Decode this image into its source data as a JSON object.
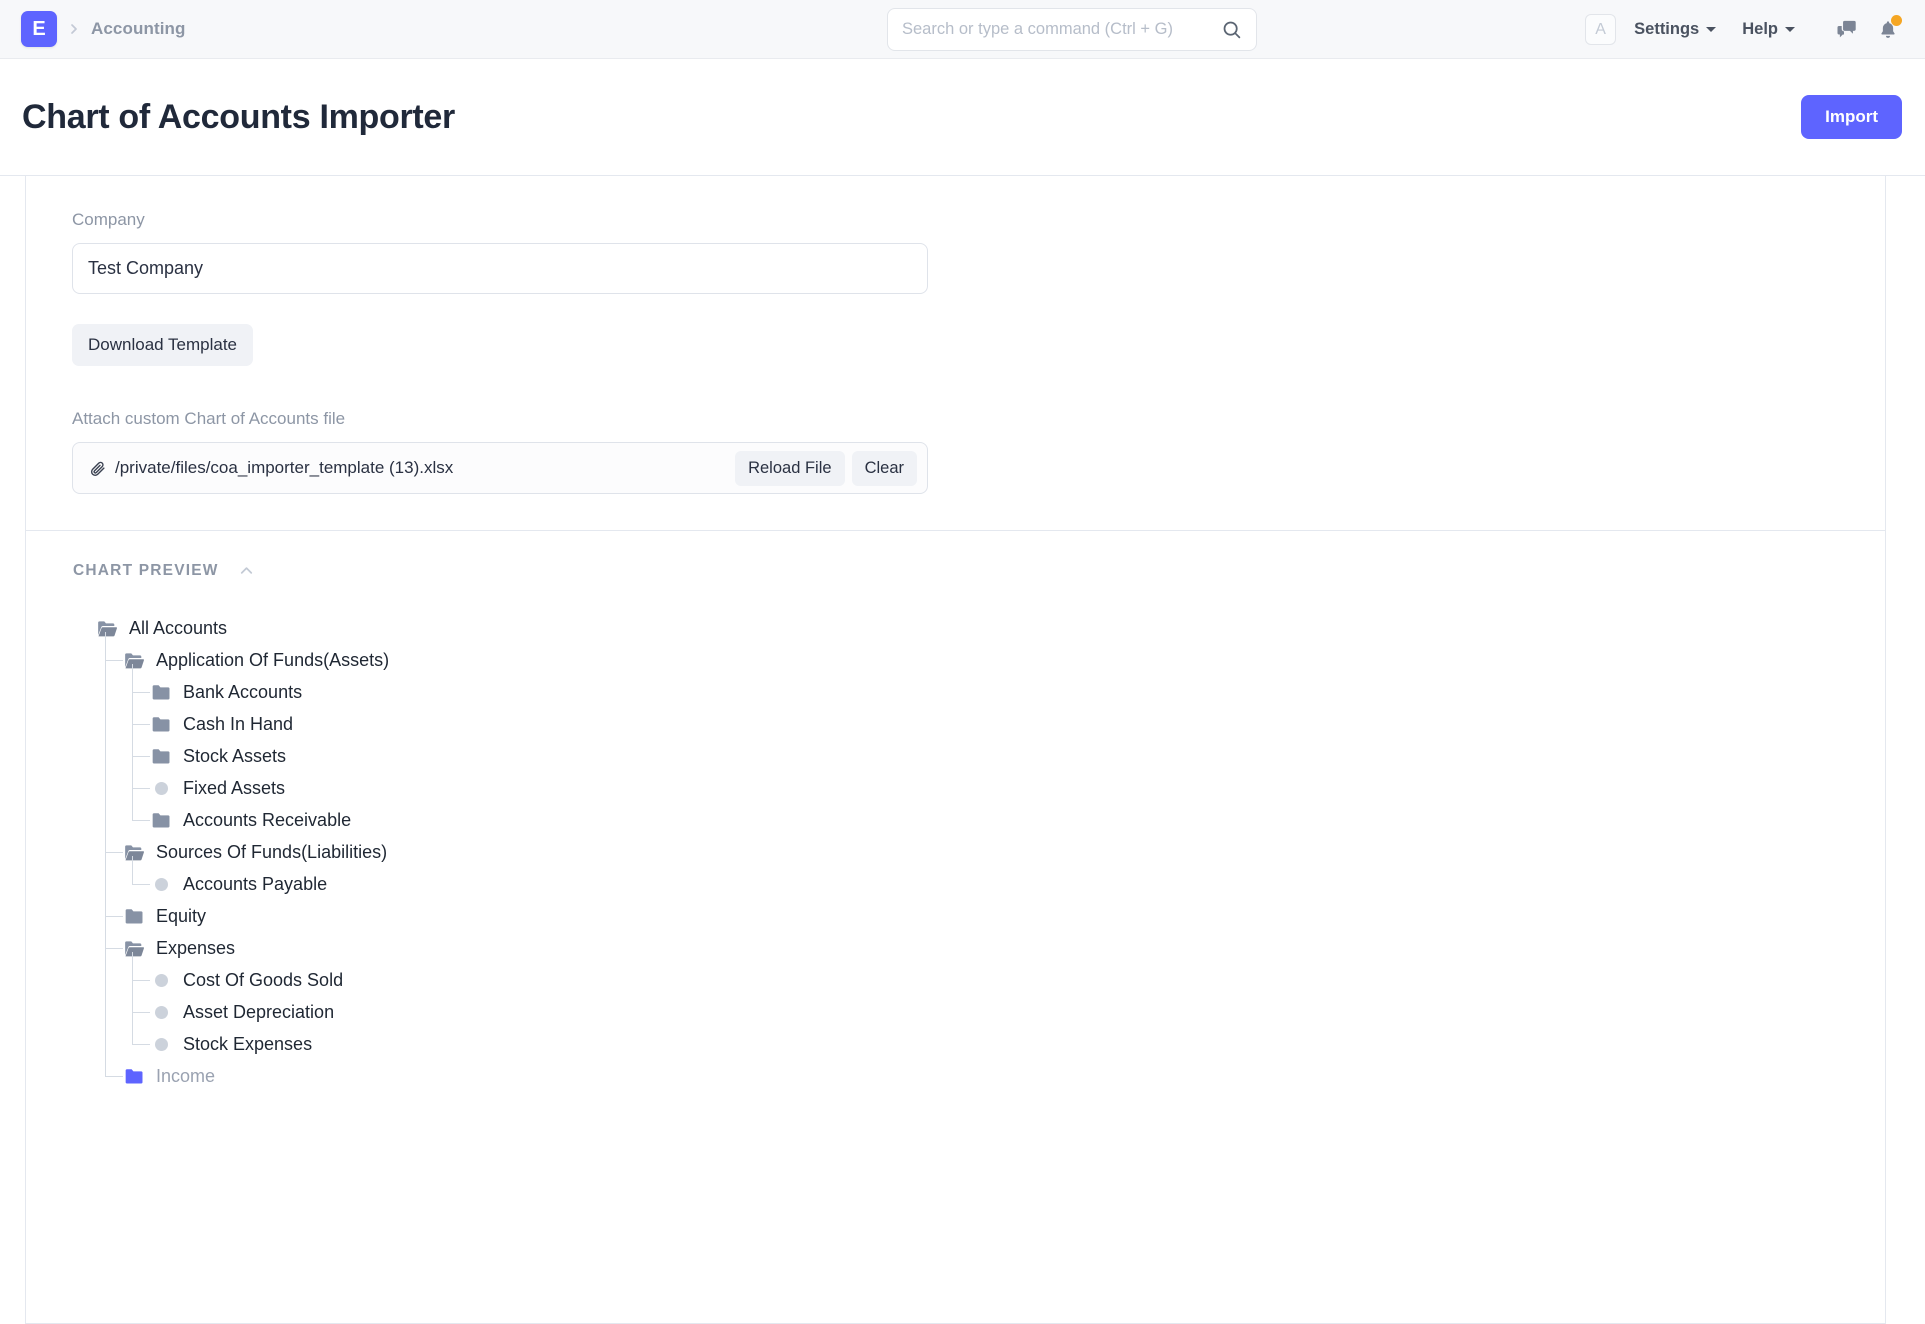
{
  "navbar": {
    "logo_letter": "E",
    "breadcrumb": "Accounting",
    "chevron_icon": "chevron-right-icon",
    "search": {
      "placeholder": "Search or type a command (Ctrl + G)",
      "value": "",
      "icon": "search-icon"
    },
    "avatar_letter": "A",
    "settings_label": "Settings",
    "help_label": "Help",
    "chat_icon": "chat-bubbles-icon",
    "bell_icon": "bell-icon",
    "has_notification": true,
    "notification_color": "#f5a623"
  },
  "page": {
    "title": "Chart of Accounts Importer",
    "import_label": "Import",
    "accent_color": "#5e64ff"
  },
  "form": {
    "company_label": "Company",
    "company_value": "Test Company",
    "company_placeholder": "",
    "download_template_label": "Download Template",
    "attach_label": "Attach custom Chart of Accounts file",
    "attach_file_name": "/private/files/coa_importer_template (13).xlsx",
    "attach_clip_icon": "paperclip-icon",
    "reload_label": "Reload File",
    "clear_label": "Clear"
  },
  "preview": {
    "section_title": "CHART PREVIEW",
    "collapse_icon": "chevron-up-icon",
    "tree": {
      "label": "All Accounts",
      "icon": "folder-open-icon",
      "children": [
        {
          "label": "Application Of Funds(Assets)",
          "icon": "folder-open-icon",
          "children": [
            {
              "label": "Bank Accounts",
              "icon": "folder-closed-icon"
            },
            {
              "label": "Cash In Hand",
              "icon": "folder-closed-icon"
            },
            {
              "label": "Stock Assets",
              "icon": "folder-closed-icon"
            },
            {
              "label": "Fixed Assets",
              "icon": "leaf-dot-icon"
            },
            {
              "label": "Accounts Receivable",
              "icon": "folder-closed-icon"
            }
          ]
        },
        {
          "label": "Sources Of Funds(Liabilities)",
          "icon": "folder-open-icon",
          "children": [
            {
              "label": "Accounts Payable",
              "icon": "leaf-dot-icon"
            }
          ]
        },
        {
          "label": "Equity",
          "icon": "folder-closed-icon"
        },
        {
          "label": "Expenses",
          "icon": "folder-open-icon",
          "children": [
            {
              "label": "Cost Of Goods Sold",
              "icon": "leaf-dot-icon"
            },
            {
              "label": "Asset Depreciation",
              "icon": "leaf-dot-icon"
            },
            {
              "label": "Stock Expenses",
              "icon": "leaf-dot-icon"
            }
          ]
        },
        {
          "label": "Income",
          "icon": "folder-active-icon",
          "state": "active"
        }
      ]
    }
  }
}
